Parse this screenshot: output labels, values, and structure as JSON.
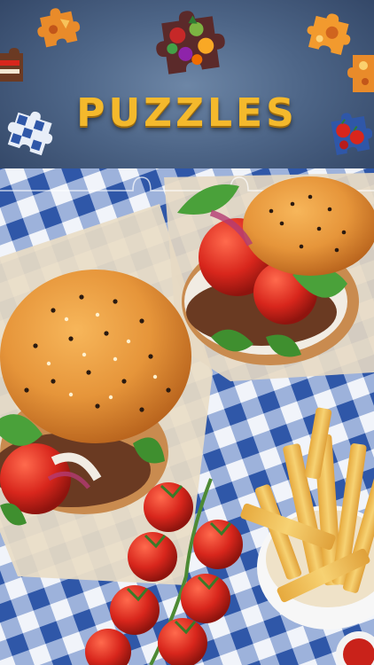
{
  "header": {
    "title": "PUZZLES"
  },
  "colors": {
    "title": "#f4b92c",
    "background": "#4d6587",
    "tablecloth_blue": "#2f57a8",
    "bun": "#e6953a",
    "tomato": "#d8261c",
    "fries": "#f2c15a"
  },
  "icons": [
    "puzzle-piece-vegetables",
    "puzzle-piece-orange",
    "puzzle-piece-burger",
    "puzzle-piece-blue",
    "puzzle-piece-cherries"
  ]
}
